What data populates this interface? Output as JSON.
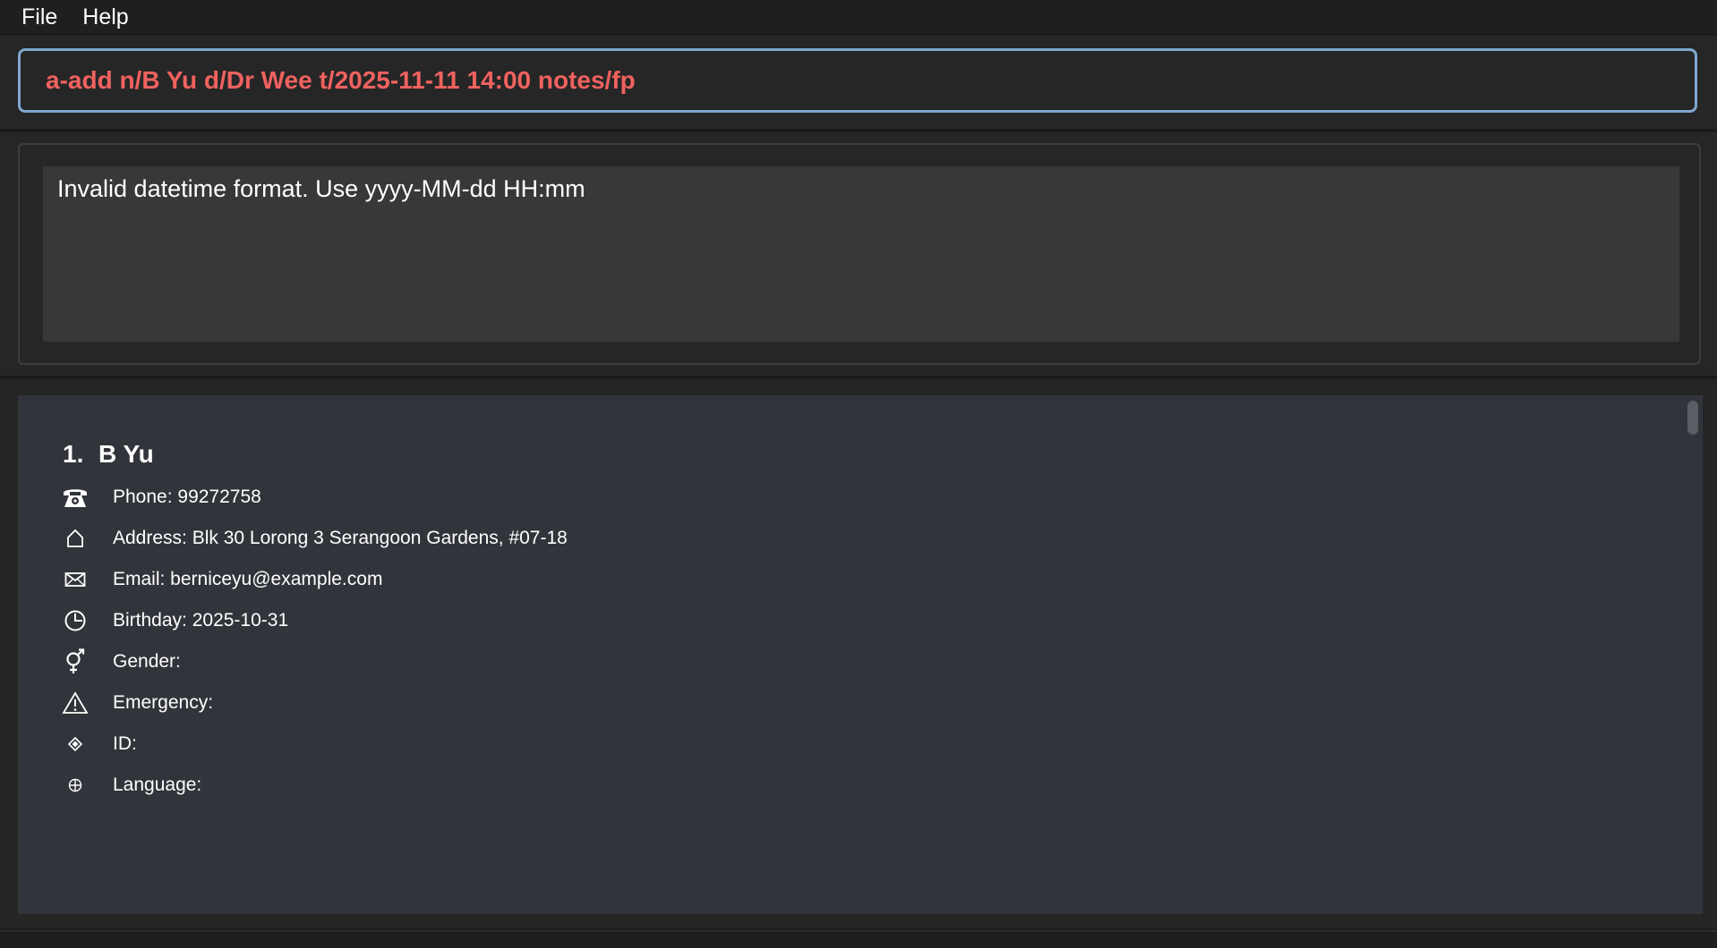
{
  "menu": {
    "file": "File",
    "help": "Help"
  },
  "command": {
    "text": "a-add n/B Yu d/Dr Wee t/2025-11-11 14:00 notes/fp",
    "color": "#f0625f"
  },
  "result": {
    "message": "Invalid datetime format. Use yyyy-MM-dd HH:mm"
  },
  "person": {
    "index": "1.",
    "name": "B Yu",
    "fields": [
      {
        "icon": "phone-icon",
        "text": "Phone: 99272758"
      },
      {
        "icon": "home-icon",
        "text": "Address: Blk 30 Lorong 3 Serangoon Gardens, #07-18"
      },
      {
        "icon": "envelope-icon",
        "text": "Email: berniceyu@example.com"
      },
      {
        "icon": "clock-icon",
        "text": "Birthday: 2025-10-31"
      },
      {
        "icon": "gender-icon",
        "text": "Gender:"
      },
      {
        "icon": "warning-icon",
        "text": "Emergency:"
      },
      {
        "icon": "diamond-icon",
        "text": "ID:"
      },
      {
        "icon": "globe-icon",
        "text": "Language:"
      }
    ]
  }
}
